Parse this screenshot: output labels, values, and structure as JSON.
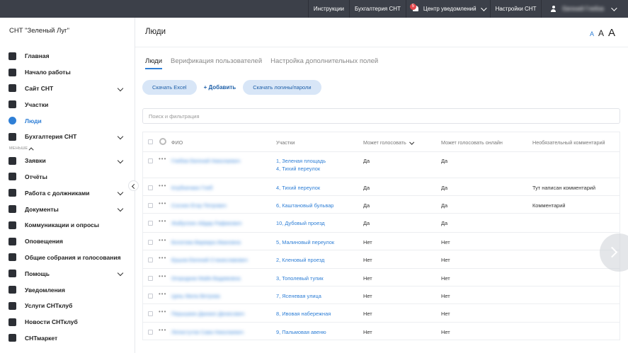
{
  "topbar": {
    "instructions": "Инструкции",
    "accounting": "Бухгалтерия СНТ",
    "notifications": "Центр уведомлений",
    "notifications_badge": "5",
    "settings": "Настройки СНТ",
    "user_name": "Евгений Глебов"
  },
  "sidebar": {
    "org_name": "СНТ \"Зеленый Луг\"",
    "less_label": "МЕНЬШЕ",
    "items": [
      {
        "label": "Главная",
        "icon": "home-icon",
        "chevron": false
      },
      {
        "label": "Начало работы",
        "icon": "start-icon",
        "chevron": false
      },
      {
        "label": "Сайт СНТ",
        "icon": "monitor-icon",
        "chevron": true
      },
      {
        "label": "Участки",
        "icon": "store-icon",
        "chevron": false
      },
      {
        "label": "Люди",
        "icon": "people-icon",
        "chevron": false,
        "active": true
      },
      {
        "label": "Бухгалтерия СНТ",
        "icon": "accounting-icon",
        "chevron": true
      },
      {
        "label": "Заявки",
        "icon": "clipboard-icon",
        "chevron": true
      },
      {
        "label": "Отчёты",
        "icon": "report-icon",
        "chevron": false
      },
      {
        "label": "Работа с должниками",
        "icon": "percent-icon",
        "chevron": true
      },
      {
        "label": "Документы",
        "icon": "document-icon",
        "chevron": true
      },
      {
        "label": "Коммуникации и опросы",
        "icon": "chat-icon",
        "chevron": false
      },
      {
        "label": "Оповещения",
        "icon": "broadcast-icon",
        "chevron": false
      },
      {
        "label": "Общие собрания и голосования",
        "icon": "vote-icon",
        "chevron": false
      },
      {
        "label": "Помощь",
        "icon": "help-icon",
        "chevron": true
      },
      {
        "label": "Уведомления",
        "icon": "bell-icon",
        "chevron": false
      },
      {
        "label": "Услуги СНТклуб",
        "icon": "briefcase-icon",
        "chevron": false
      },
      {
        "label": "Новости СНТклуб",
        "icon": "news-icon",
        "chevron": false
      },
      {
        "label": "СНТмаркет",
        "icon": "cart-icon",
        "chevron": false
      }
    ]
  },
  "header": {
    "title": "Люди",
    "font_small": "A",
    "font_medium": "A",
    "font_large": "A"
  },
  "tabs": [
    "Люди",
    "Верификация пользователей",
    "Настройка дополнительных полей"
  ],
  "actions": {
    "download_excel": "Скачать Excel",
    "add": "+ Добавить",
    "download_logins": "Скачать логины/пароли"
  },
  "search": {
    "placeholder": "Поиск и фильтрация"
  },
  "table": {
    "columns": [
      "ФИО",
      "Участки",
      "Может голосовать",
      "Может голосовать онлайн",
      "Необязательный комментарий"
    ],
    "rows": [
      {
        "name": "Глебов Евгений Николаевич",
        "plots": [
          "1, Зеленая площадь",
          "4, Тихий переулок"
        ],
        "vote": "Да",
        "online": "Да",
        "comment": ""
      },
      {
        "name": "Клубничкин Глеб",
        "plots": [
          "4, Тихий переулок"
        ],
        "vote": "Да",
        "online": "Да",
        "comment": "Тут написан комментарий"
      },
      {
        "name": "Соснин Егор Петрович",
        "plots": [
          "6, Каштановый бульвар"
        ],
        "vote": "Да",
        "online": "Да",
        "comment": "Комментарий"
      },
      {
        "name": "Жабуллин Айдар Рафикович",
        "plots": [
          "10, Дубовый проезд"
        ],
        "vote": "Да",
        "online": "Да",
        "comment": ""
      },
      {
        "name": "Богатова Варвара Ивановна",
        "plots": [
          "5, Малиновый переулок"
        ],
        "vote": "Нет",
        "online": "Нет",
        "comment": ""
      },
      {
        "name": "Ершов Евгений Станиславович",
        "plots": [
          "2, Кленовый проезд"
        ],
        "vote": "Нет",
        "online": "Нет",
        "comment": ""
      },
      {
        "name": "Огородник Майя Вадимовна",
        "plots": [
          "3, Тополевый тупик"
        ],
        "vote": "Нет",
        "online": "Нет",
        "comment": ""
      },
      {
        "name": "Цинь Мила Ветрова",
        "plots": [
          "7, Ясеневая улица"
        ],
        "vote": "Нет",
        "online": "Нет",
        "comment": ""
      },
      {
        "name": "Перышкин Даниил Денисович",
        "plots": [
          "8, Ивовая набережная"
        ],
        "vote": "Нет",
        "online": "Нет",
        "comment": ""
      },
      {
        "name": "Лепистутов Сава Николаевич",
        "plots": [
          "9, Пальмовая авеню"
        ],
        "vote": "Нет",
        "online": "Нет",
        "comment": ""
      }
    ]
  }
}
